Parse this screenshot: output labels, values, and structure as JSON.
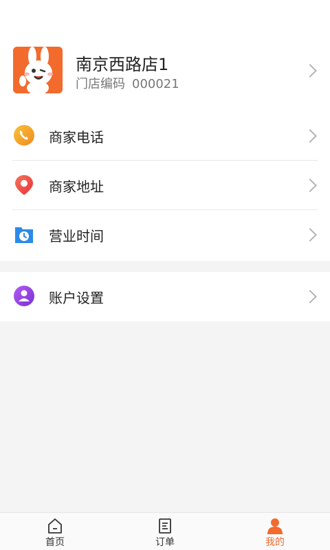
{
  "store": {
    "name": "南京西路店1",
    "code_label": "门店编码",
    "code_value": "000021"
  },
  "menu": {
    "items": [
      {
        "label": "商家电话",
        "icon": "phone-icon"
      },
      {
        "label": "商家地址",
        "icon": "location-pin-icon"
      },
      {
        "label": "营业时间",
        "icon": "clock-icon"
      }
    ],
    "account": {
      "label": "账户设置",
      "icon": "user-icon"
    }
  },
  "tabbar": {
    "tabs": [
      {
        "label": "首页",
        "icon": "home-icon"
      },
      {
        "label": "订单",
        "icon": "order-icon"
      },
      {
        "label": "我的",
        "icon": "profile-icon",
        "active": true
      }
    ]
  },
  "colors": {
    "accent": "#f26a2c",
    "phone": "#f5a623",
    "location": "#f0513e",
    "clock": "#2b8be8",
    "account": "#8e44dd"
  }
}
